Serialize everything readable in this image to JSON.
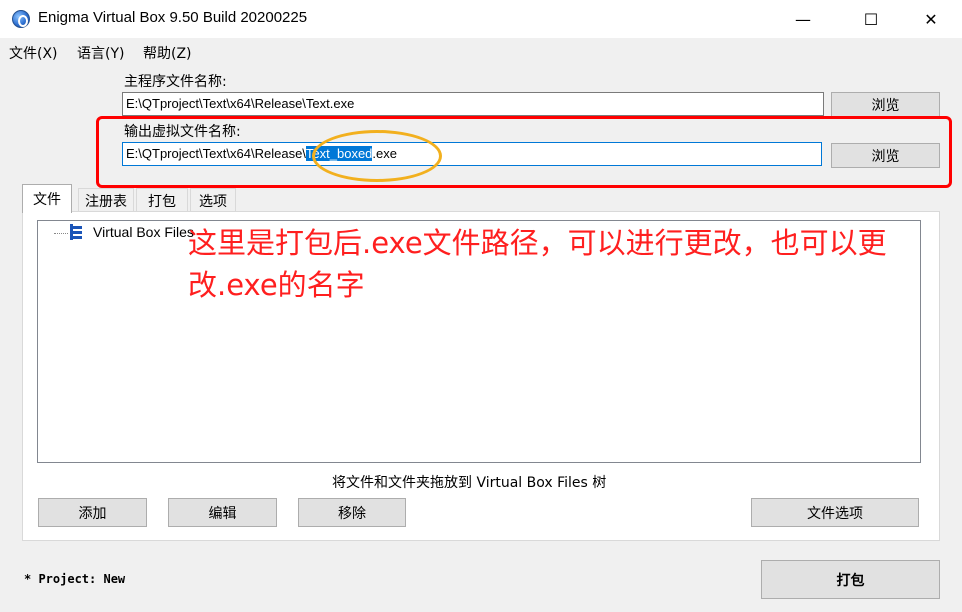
{
  "window": {
    "title": "Enigma Virtual Box 9.50 Build 20200225",
    "minimize": "—",
    "maximize": "☐",
    "close": "✕"
  },
  "menu": {
    "file": "文件(X)",
    "language": "语言(Y)",
    "help": "帮助(Z)"
  },
  "main_program": {
    "label": "主程序文件名称:",
    "value": "E:\\QTproject\\Text\\x64\\Release\\Text.exe",
    "browse": "浏览"
  },
  "output": {
    "label": "输出虚拟文件名称:",
    "value_prefix": "E:\\QTproject\\Text\\x64\\Release\\",
    "value_selected": "Text_boxed",
    "value_suffix": ".exe",
    "browse": "浏览"
  },
  "tabs": [
    {
      "label": "文件",
      "active": true
    },
    {
      "label": "注册表"
    },
    {
      "label": "打包"
    },
    {
      "label": "选项"
    }
  ],
  "tree": {
    "root": "Virtual Box Files"
  },
  "annotation": "这里是打包后.exe文件路径，可以进行更改，也可以更改.exe的名字",
  "hint": "将文件和文件夹拖放到 Virtual Box Files 树",
  "buttons": {
    "add": "添加",
    "edit": "编辑",
    "remove": "移除",
    "file_options": "文件选项",
    "pack": "打包"
  },
  "status": "* Project: New",
  "colors": {
    "annotation": "#ff1f1f",
    "highlight_box": "#ff0000",
    "highlight_ellipse": "#f2b01e",
    "selection": "#0078d7"
  }
}
